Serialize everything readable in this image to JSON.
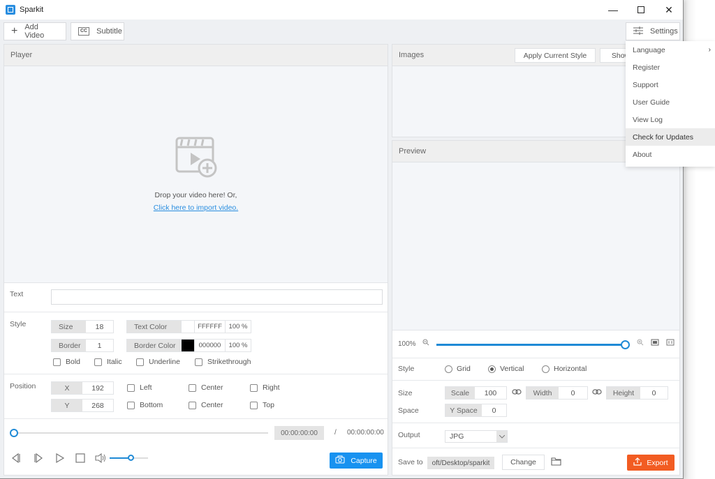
{
  "window": {
    "title": "Sparkit",
    "controls": {
      "minimize": "—",
      "maximize": "☐",
      "close": "✕"
    }
  },
  "toolbar": {
    "add_video_label": "Add Video",
    "subtitle_label": "Subtitle",
    "settings_label": "Settings"
  },
  "settings_menu": {
    "items": [
      {
        "label": "Language",
        "has_submenu": true
      },
      {
        "label": "Register"
      },
      {
        "label": "Support"
      },
      {
        "label": "User Guide"
      },
      {
        "label": "View Log"
      },
      {
        "label": "Check for Updates",
        "highlighted": true
      },
      {
        "label": "About"
      }
    ],
    "submenu_arrow": "›"
  },
  "player": {
    "title": "Player",
    "drop_text": "Drop your video here! Or,",
    "import_link": "Click here to import video.",
    "text_label": "Text",
    "text_value": "",
    "style_label": "Style",
    "size_label": "Size",
    "size_value": "18",
    "border_label": "Border",
    "border_value": "1",
    "text_color_label": "Text Color",
    "text_color_hex": "FFFFFF",
    "text_color_swatch": "#ffffff",
    "text_color_opacity": "100 %",
    "border_color_label": "Border Color",
    "border_color_hex": "000000",
    "border_color_swatch": "#000000",
    "border_color_opacity": "100 %",
    "checkboxes": [
      {
        "label": "Bold",
        "checked": false
      },
      {
        "label": "Italic",
        "checked": false
      },
      {
        "label": "Underline",
        "checked": false
      },
      {
        "label": "Strikethrough",
        "checked": false
      }
    ],
    "position_label": "Position",
    "x_label": "X",
    "x_value": "192",
    "y_label": "Y",
    "y_value": "268",
    "align_row1": [
      "Left",
      "Center",
      "Right"
    ],
    "align_row2": [
      "Bottom",
      "Center",
      "Top"
    ],
    "current_time": "00:00:00:00",
    "time_separator": "/",
    "total_time": "00:00:00:00",
    "seek_progress": 0,
    "volume_level": 0.55,
    "capture_label": "Capture"
  },
  "images": {
    "title": "Images",
    "apply_style_label": "Apply Current Style",
    "show_label": "Show"
  },
  "preview": {
    "title": "Preview",
    "zoom_label": "100%",
    "zoom_level": 1.0,
    "style_label": "Style",
    "style_options": [
      {
        "label": "Grid",
        "selected": false
      },
      {
        "label": "Vertical",
        "selected": true
      },
      {
        "label": "Horizontal",
        "selected": false
      }
    ],
    "size_label": "Size",
    "scale_label": "Scale",
    "scale_value": "100",
    "width_label": "Width",
    "width_value": "0",
    "height_label": "Height",
    "height_value": "0",
    "space_label": "Space",
    "yspace_label": "Y Space",
    "yspace_value": "0",
    "output_label": "Output",
    "output_value": "JPG",
    "save_to_label": "Save to",
    "save_path": "oft/Desktop/sparkit",
    "change_label": "Change",
    "export_label": "Export"
  },
  "colors": {
    "accent_blue": "#1892f0",
    "export_orange": "#f25c22",
    "link_blue": "#2a8ee0"
  }
}
